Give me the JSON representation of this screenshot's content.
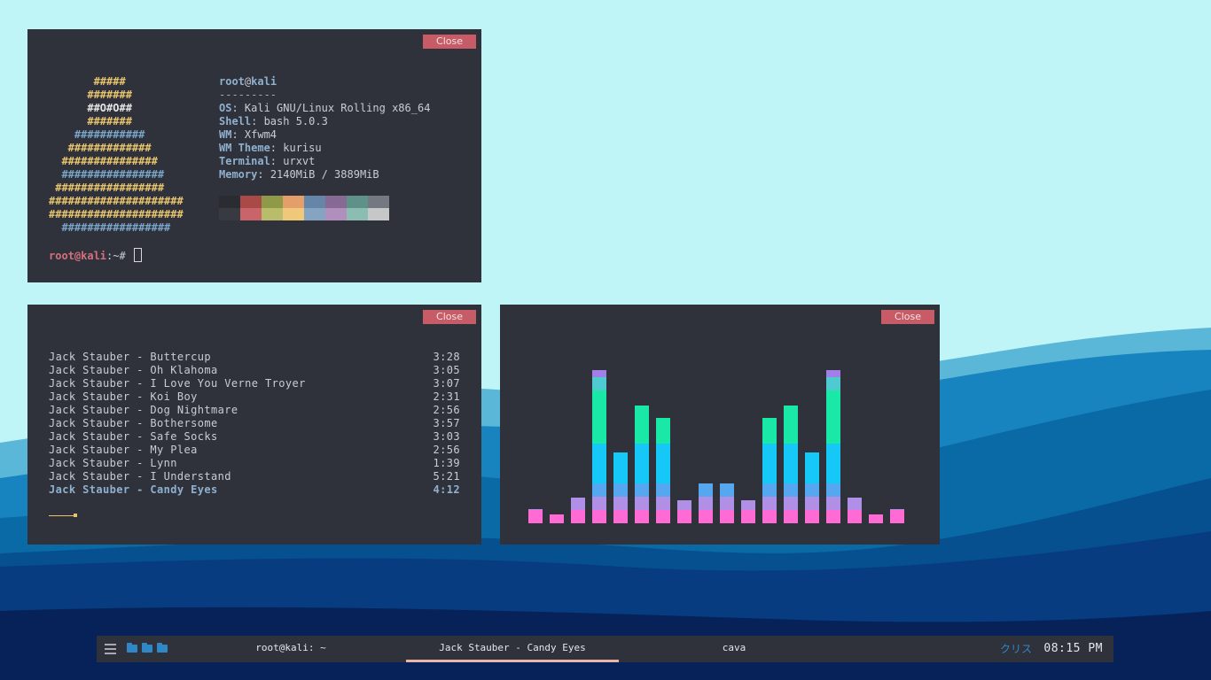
{
  "desktop": {
    "corner_label": "",
    "colors": {
      "sky": "#bff5f6",
      "mountain_light": "#0a6aa6",
      "mountain_dark": "#063a7c",
      "ground": "#061c4e"
    }
  },
  "neofetch_window": {
    "close_label": "Close",
    "ascii_art": [
      "       #####",
      "      #######",
      "      ##O#O##",
      "      #######",
      "    ###########",
      "   #############",
      "  ###############",
      "  ################",
      " #################",
      "#####################",
      "#####################",
      "  #################"
    ],
    "user": "root",
    "at": "@",
    "host": "kali",
    "separator": "---------",
    "info": [
      {
        "key": "OS",
        "value": "Kali GNU/Linux Rolling x86_64"
      },
      {
        "key": "Shell",
        "value": "bash 5.0.3"
      },
      {
        "key": "WM",
        "value": "Xfwm4"
      },
      {
        "key": "WM Theme",
        "value": "kurisu"
      },
      {
        "key": "Terminal",
        "value": "urxvt"
      },
      {
        "key": "Memory",
        "value": "2140MiB / 3889MiB"
      }
    ],
    "palette": {
      "normal": [
        "#2a2c31",
        "#a94a47",
        "#8f9a48",
        "#e39e69",
        "#6686a9",
        "#866a93",
        "#5e9187",
        "#747880"
      ],
      "bright": [
        "#373a41",
        "#c8646a",
        "#b9bd6b",
        "#efc87a",
        "#85a4c1",
        "#b08fbd",
        "#8bbdb3",
        "#c5c8c6"
      ]
    },
    "prompt": {
      "user_host": "root@kali",
      "path": ":~# "
    }
  },
  "music_window": {
    "close_label": "Close",
    "tracks": [
      {
        "title": "Jack Stauber - Buttercup",
        "duration": "3:28"
      },
      {
        "title": "Jack Stauber - Oh Klahoma",
        "duration": "3:05"
      },
      {
        "title": "Jack Stauber - I Love You Verne Troyer",
        "duration": "3:07"
      },
      {
        "title": "Jack Stauber - Koi Boy",
        "duration": "2:31"
      },
      {
        "title": "Jack Stauber - Dog Nightmare",
        "duration": "2:56"
      },
      {
        "title": "Jack Stauber - Bothersome",
        "duration": "3:57"
      },
      {
        "title": "Jack Stauber - Safe Socks",
        "duration": "3:03"
      },
      {
        "title": "Jack Stauber - My Plea",
        "duration": "2:56"
      },
      {
        "title": "Jack Stauber - Lynn",
        "duration": "1:39"
      },
      {
        "title": "Jack Stauber - I Understand",
        "duration": "5:21"
      },
      {
        "title": "Jack Stauber - Candy Eyes",
        "duration": "4:12"
      }
    ],
    "current_track_index": 10,
    "playback_progress": 0.12
  },
  "cava_window": {
    "close_label": "Close",
    "bar_levels": [
      0.09,
      0.06,
      0.17,
      1.0,
      0.46,
      0.77,
      0.69,
      0.15,
      0.26,
      0.26,
      0.15,
      0.69,
      0.77,
      0.46,
      1.0,
      0.17,
      0.06,
      0.09
    ],
    "gradient_colors": [
      "#ff6ad5",
      "#b08fe6",
      "#55a7f0",
      "#15c8f7",
      "#1ae8a6",
      "#4ecbd1",
      "#a27ee8"
    ]
  },
  "taskbar": {
    "tasks": [
      {
        "label": "root@kali: ~",
        "active": false
      },
      {
        "label": "Jack Stauber - Candy Eyes",
        "active": true
      },
      {
        "label": "cava",
        "active": false
      }
    ],
    "lang": "クリス",
    "clock": "08:15 PM"
  }
}
